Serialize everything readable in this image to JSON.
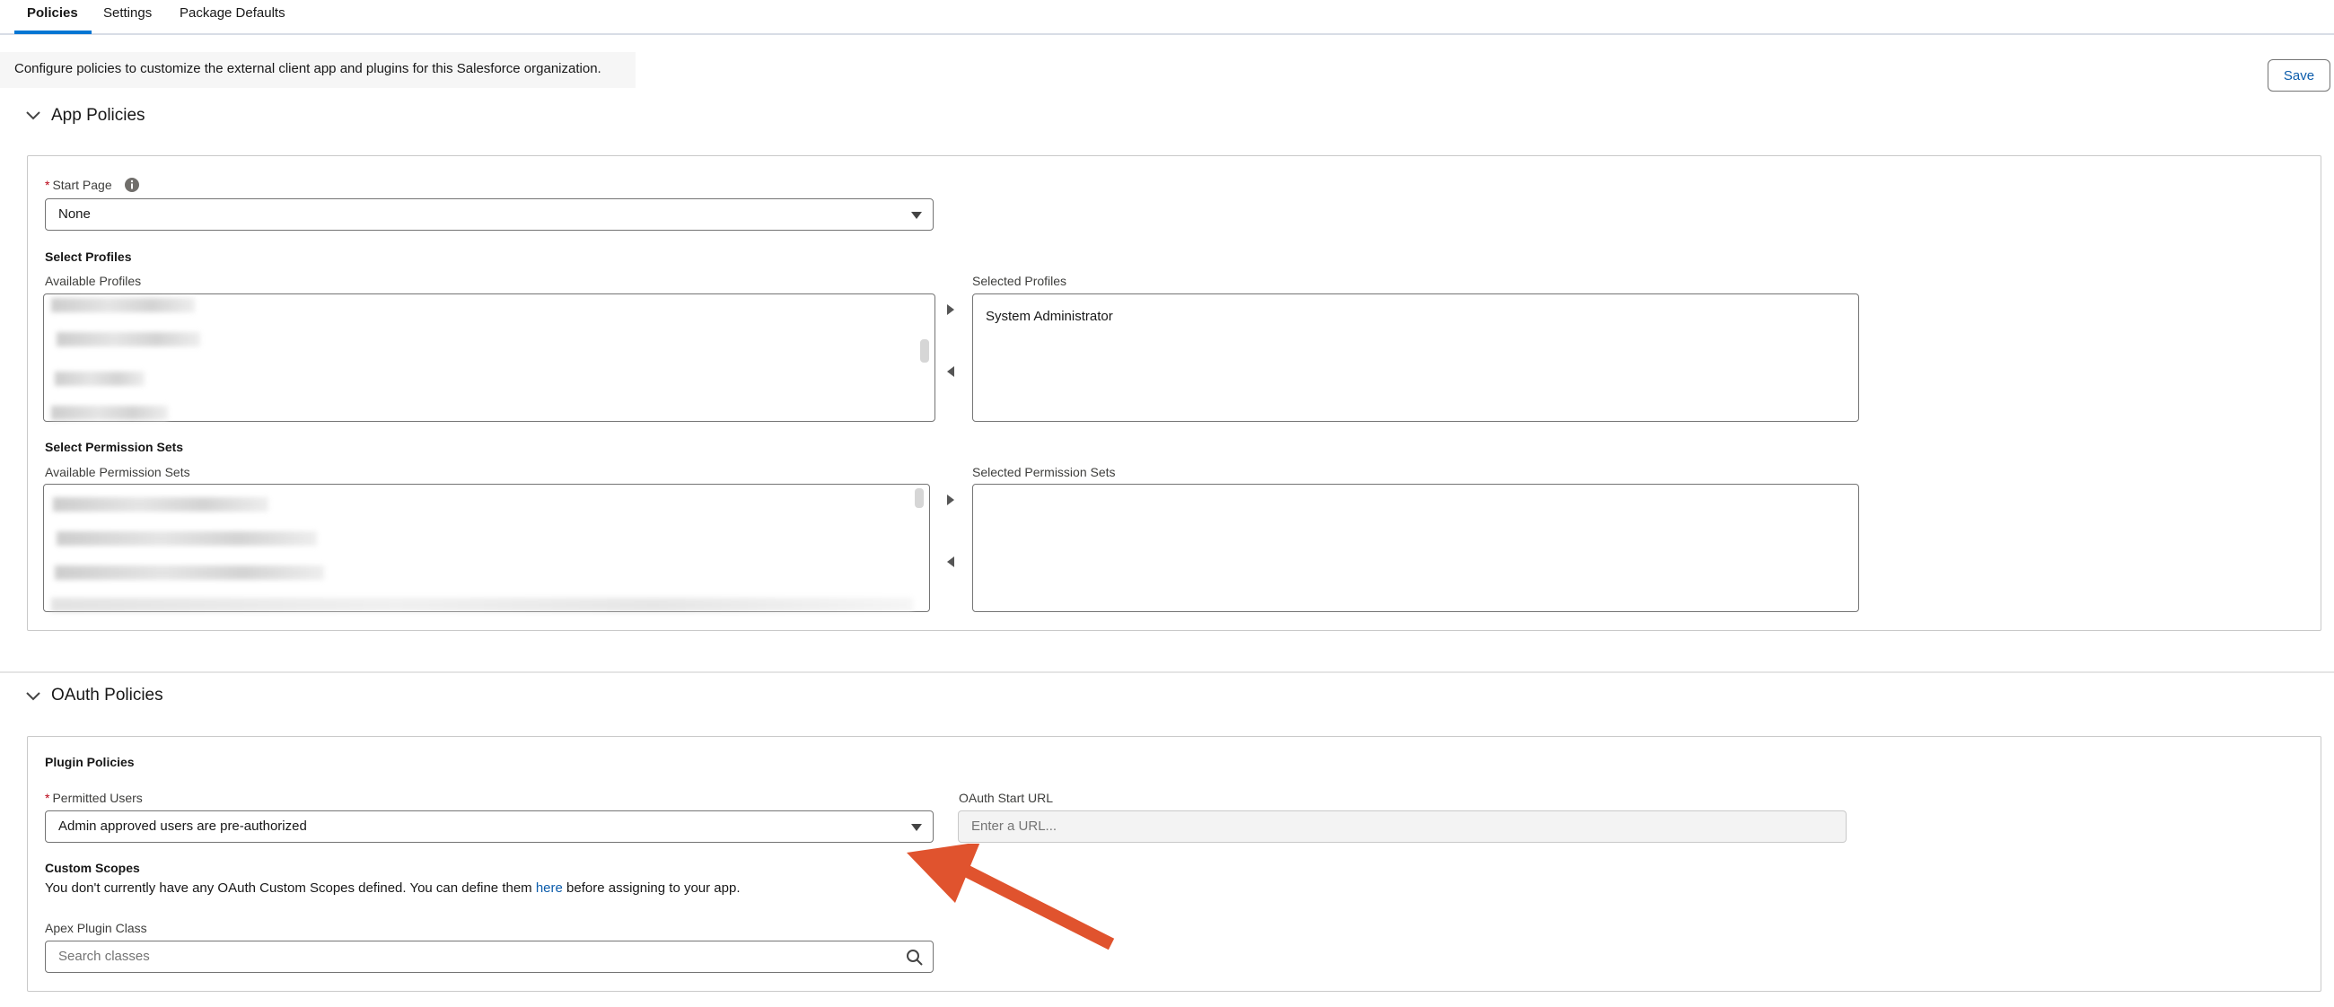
{
  "tabs": [
    {
      "label": "Policies",
      "active": true
    },
    {
      "label": "Settings",
      "active": false
    },
    {
      "label": "Package Defaults",
      "active": false
    }
  ],
  "description": "Configure policies to customize the external client app and plugins for this Salesforce organization.",
  "save_label": "Save",
  "app_policies": {
    "title": "App Policies",
    "start_page_label": "Start Page",
    "start_page_value": "None",
    "select_profiles": "Select Profiles",
    "available_profiles": "Available Profiles",
    "selected_profiles": "Selected Profiles",
    "selected_profiles_items": [
      "System Administrator"
    ],
    "select_permission_sets": "Select Permission Sets",
    "available_permission_sets": "Available Permission Sets",
    "selected_permission_sets": "Selected Permission Sets"
  },
  "oauth_policies": {
    "title": "OAuth Policies",
    "plugin_policies": "Plugin Policies",
    "permitted_users_label": "Permitted Users",
    "permitted_users_value": "Admin approved users are pre-authorized",
    "oauth_start_url_label": "OAuth Start URL",
    "oauth_start_url_placeholder": "Enter a URL...",
    "custom_scopes": "Custom Scopes",
    "custom_scopes_text_before": "You don't currently have any OAuth Custom Scopes defined. You can define them ",
    "custom_scopes_link": "here",
    "custom_scopes_text_after": " before assigning to your app.",
    "apex_plugin_label": "Apex Plugin Class",
    "apex_plugin_placeholder": "Search classes"
  },
  "colors": {
    "accent": "#0176d3",
    "link": "#0b5cab",
    "required": "#ba0517",
    "annotation_arrow": "#e0532e"
  },
  "icons": {
    "info": "info-icon",
    "chevron": "chevron-down-icon",
    "search": "search-icon"
  }
}
